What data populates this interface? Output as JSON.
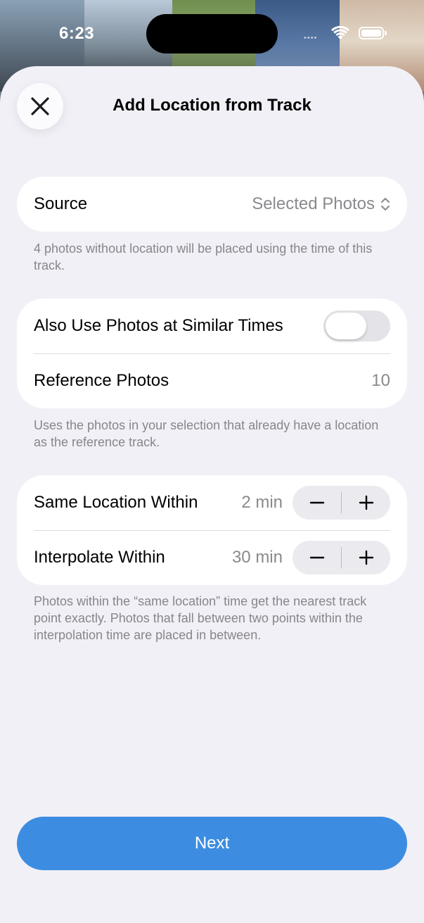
{
  "status_bar": {
    "time": "6:23"
  },
  "sheet": {
    "title": "Add Location from Track"
  },
  "source": {
    "label": "Source",
    "value": "Selected Photos",
    "footnote": "4 photos without location will be placed using the time of this track."
  },
  "similar_times": {
    "label": "Also Use Photos at Similar Times",
    "enabled": false,
    "reference_label": "Reference Photos",
    "reference_count": "10",
    "footnote": "Uses the photos in your selection that already have a location as the reference track."
  },
  "timing": {
    "same_location_label": "Same Location Within",
    "same_location_value": "2 min",
    "interpolate_label": "Interpolate Within",
    "interpolate_value": "30 min",
    "footnote": "Photos within the “same location” time get the nearest track point exactly. Photos that fall between two points within the interpolation time are placed in between."
  },
  "actions": {
    "next_label": "Next"
  },
  "colors": {
    "accent": "#3c8de1",
    "sheet_bg": "#f1f0f6",
    "secondary_text": "#8a8a8e"
  },
  "icons": [
    "close-icon",
    "chevron-up-down-icon",
    "minus-icon",
    "plus-icon",
    "wifi-icon",
    "battery-icon"
  ]
}
